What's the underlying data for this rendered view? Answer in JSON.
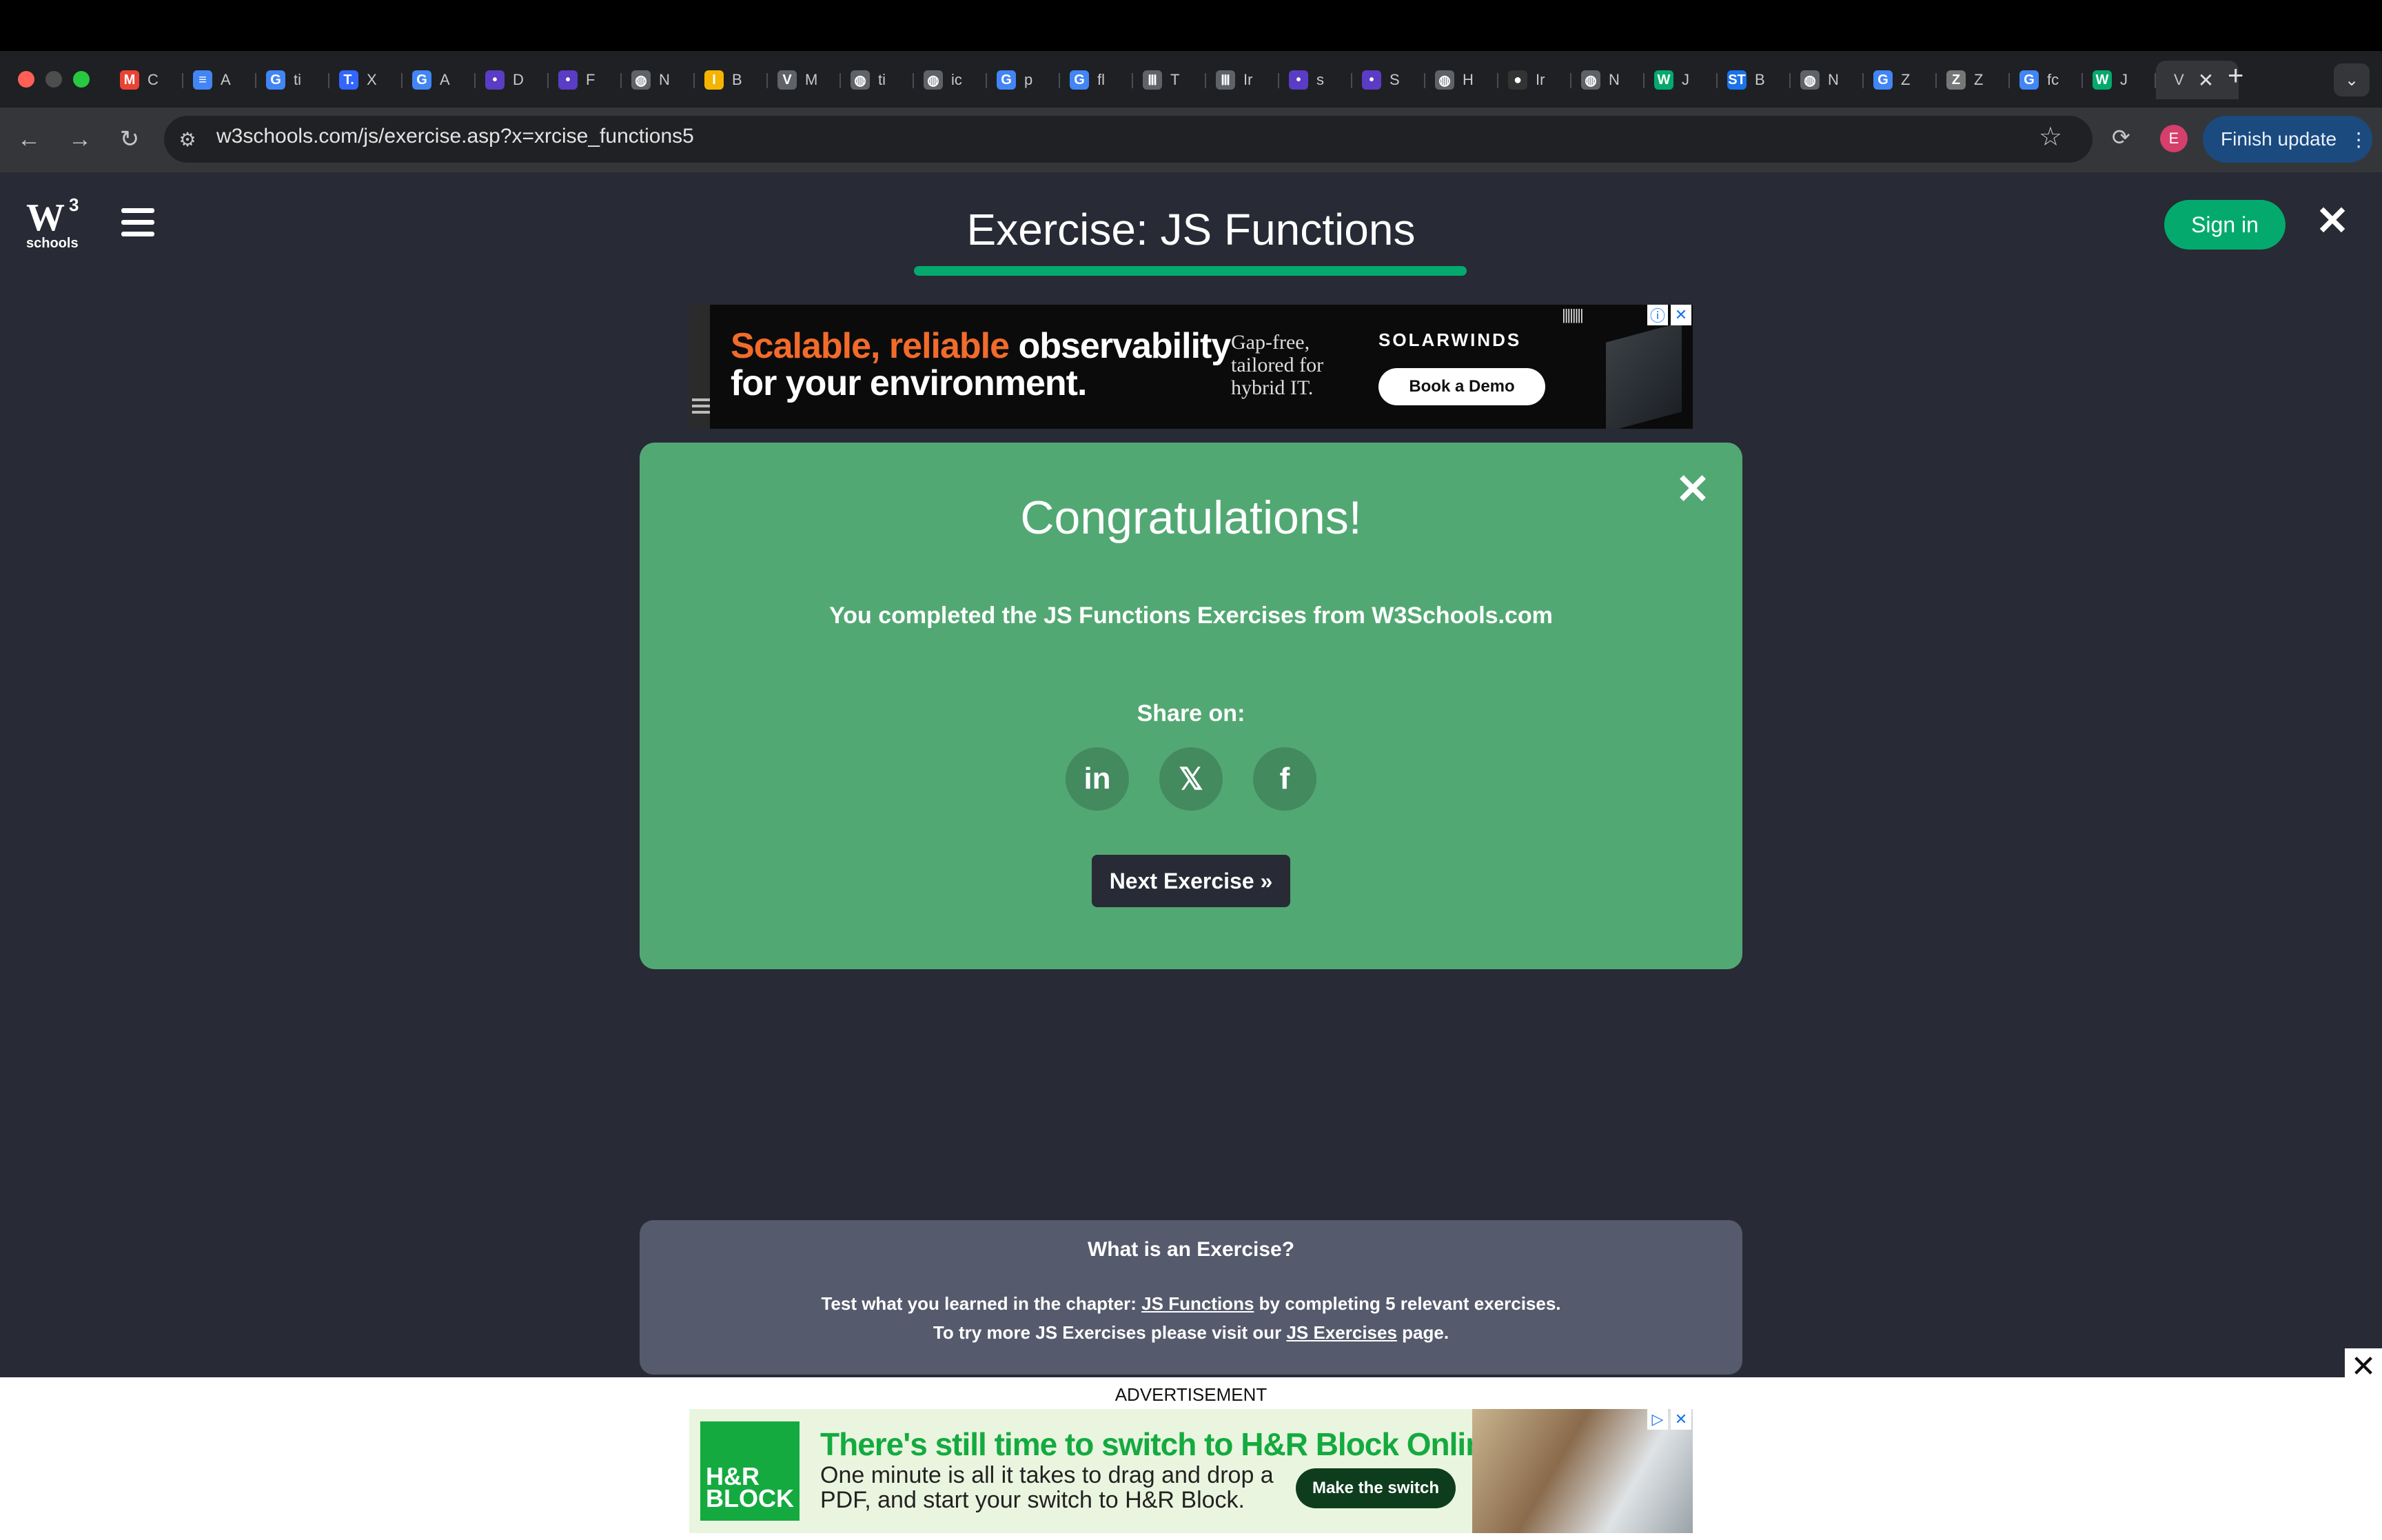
{
  "browser": {
    "tabs": [
      {
        "icon": "gmail-icon",
        "letter": "M",
        "label": "C",
        "color": "#ea4335"
      },
      {
        "icon": "docs-icon",
        "letter": "≡",
        "label": "A",
        "color": "#4285f4"
      },
      {
        "icon": "google-icon",
        "letter": "G",
        "label": "ti",
        "color": "#4285f4"
      },
      {
        "icon": "t-icon",
        "letter": "T.",
        "label": "X",
        "color": "#3366ff"
      },
      {
        "icon": "google-icon",
        "letter": "G",
        "label": "A",
        "color": "#4285f4"
      },
      {
        "icon": "pin-icon",
        "letter": "•",
        "label": "D",
        "color": "#5b3cc4"
      },
      {
        "icon": "pin-icon",
        "letter": "•",
        "label": "F",
        "color": "#5b3cc4"
      },
      {
        "icon": "globe-icon",
        "letter": "◍",
        "label": "N",
        "color": "#5f6368"
      },
      {
        "icon": "i-icon",
        "letter": "I",
        "label": "B",
        "color": "#f4b400"
      },
      {
        "icon": "v-icon",
        "letter": "V",
        "label": "M",
        "color": "#5f6368"
      },
      {
        "icon": "globe-icon",
        "letter": "◍",
        "label": "ti",
        "color": "#5f6368"
      },
      {
        "icon": "globe-icon",
        "letter": "◍",
        "label": "ic",
        "color": "#5f6368"
      },
      {
        "icon": "google-icon",
        "letter": "G",
        "label": "p",
        "color": "#4285f4"
      },
      {
        "icon": "google-icon",
        "letter": "G",
        "label": "fl",
        "color": "#4285f4"
      },
      {
        "icon": "bank-icon",
        "letter": "Ⅲ",
        "label": "T",
        "color": "#5f6368"
      },
      {
        "icon": "bank-icon",
        "letter": "Ⅲ",
        "label": "Ir",
        "color": "#5f6368"
      },
      {
        "icon": "pin-icon",
        "letter": "•",
        "label": "s",
        "color": "#5b3cc4"
      },
      {
        "icon": "pin-icon",
        "letter": "•",
        "label": "S",
        "color": "#5b3cc4"
      },
      {
        "icon": "globe-icon",
        "letter": "◍",
        "label": "H",
        "color": "#5f6368"
      },
      {
        "icon": "github-icon",
        "letter": "●",
        "label": "Ir",
        "color": "#333333"
      },
      {
        "icon": "globe-icon",
        "letter": "◍",
        "label": "N",
        "color": "#5f6368"
      },
      {
        "icon": "w3-icon",
        "letter": "W",
        "label": "J",
        "color": "#04aa6d"
      },
      {
        "icon": "st-icon",
        "letter": "ST",
        "label": "B",
        "color": "#1a73e8"
      },
      {
        "icon": "globe-icon",
        "letter": "◍",
        "label": "N",
        "color": "#5f6368"
      },
      {
        "icon": "google-icon",
        "letter": "G",
        "label": "Z",
        "color": "#4285f4"
      },
      {
        "icon": "z-icon",
        "letter": "Z",
        "label": "Z",
        "color": "#777777"
      },
      {
        "icon": "google-icon",
        "letter": "G",
        "label": "fc",
        "color": "#4285f4"
      },
      {
        "icon": "w3-icon",
        "letter": "W",
        "label": "J",
        "color": "#04aa6d"
      }
    ],
    "active_tab": {
      "label": "V",
      "close": "✕"
    },
    "new_tab": "+",
    "url": "w3schools.com/js/exercise.asp?x=xrcise_functions5",
    "profile_initial": "E",
    "finish_update": "Finish update"
  },
  "page": {
    "logo": {
      "mark": "W",
      "sup": "3",
      "text": "schools"
    },
    "title": "Exercise: JS Functions",
    "sign_in": "Sign in",
    "close": "✕"
  },
  "ad_top": {
    "headline_orange": "Scalable, reliable",
    "headline_white": " observability",
    "headline_line2": "for your environment.",
    "subtext": "Gap-free, tailored for hybrid IT.",
    "brand": "SOLARWINDS",
    "cta": "Book a Demo"
  },
  "congrats_card": {
    "title": "Congratulations!",
    "message": "You completed the JS Functions Exercises from W3Schools.com",
    "share_label": "Share on:",
    "share": [
      {
        "name": "linkedin-icon",
        "glyph": "in"
      },
      {
        "name": "x-icon",
        "glyph": "𝕏"
      },
      {
        "name": "facebook-icon",
        "glyph": "f"
      }
    ],
    "next_button": "Next Exercise »",
    "close": "✕"
  },
  "info": {
    "title": "What is an Exercise?",
    "line1_pre": "Test what you learned in the chapter: ",
    "line1_link": "JS Functions",
    "line1_post": " by completing 5 relevant exercises.",
    "line2_pre": "To try more JS Exercises please visit our ",
    "line2_link": "JS Exercises",
    "line2_post": " page."
  },
  "ad_bottom": {
    "label": "ADVERTISEMENT",
    "logo_text": "H&R BLOCK",
    "headline": "There's still time to switch to H&R Block Online.",
    "body": "One minute is all it takes to drag and drop a PDF, and start your switch to H&R Block.",
    "cta": "Make the switch",
    "close": "✕"
  },
  "colors": {
    "brand_green": "#04aa6d",
    "card_green": "#52a873",
    "page_bg": "#282a35",
    "info_bg": "#555a6c"
  }
}
